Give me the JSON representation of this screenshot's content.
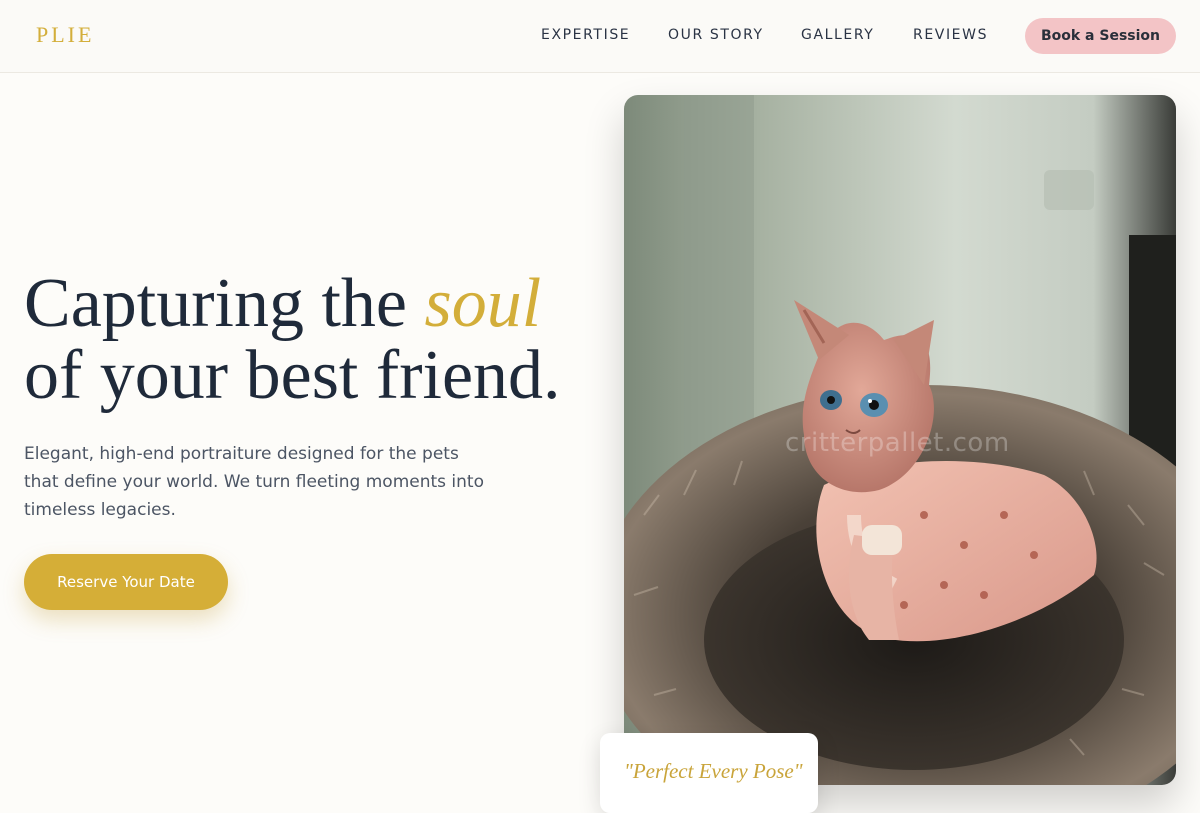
{
  "brand": {
    "name": "PLIE"
  },
  "nav": {
    "links": [
      "EXPERTISE",
      "OUR STORY",
      "GALLERY",
      "REVIEWS"
    ],
    "cta": "Book a Session"
  },
  "hero": {
    "title_part1": "Capturing the ",
    "title_accent": "soul",
    "title_part2": "of your best friend.",
    "subtitle": "Elegant, high-end portraiture designed for the pets that define your world. We turn fleeting moments into timeless legacies.",
    "cta": "Reserve Your Date"
  },
  "photo": {
    "subject": "hairless sphynx cat in pink sweater sitting in fluffy pet bed",
    "watermark": "critterpallet.com"
  },
  "testimonial": {
    "quote": "\"Perfect Every Pose\""
  },
  "colors": {
    "accent_gold": "#d5ae37",
    "cta_pink": "#f3c4c6",
    "text_dark": "#1f2a3a",
    "background": "#fdfcf9"
  }
}
